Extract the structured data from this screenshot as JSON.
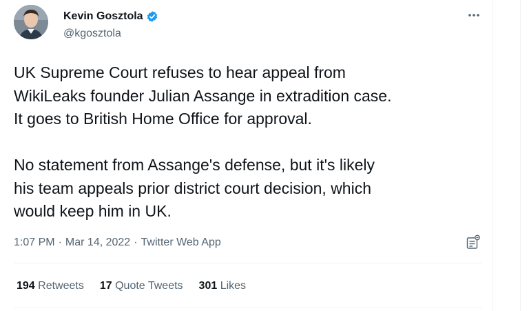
{
  "author": {
    "name": "Kevin Gosztola",
    "handle": "@kgosztola",
    "verified": true
  },
  "tweet": {
    "text": "UK Supreme Court refuses to hear appeal from\nWikiLeaks founder Julian Assange in extradition case.\nIt goes to British Home Office for approval.\n\nNo statement from Assange's defense, but it's likely\nhis team appeals prior district court decision, which\nwould keep him in UK.",
    "time": "1:07 PM",
    "separator": "·",
    "date": "Mar 14, 2022",
    "source": "Twitter Web App"
  },
  "stats": {
    "retweets_count": "194",
    "retweets_label": "Retweets",
    "quotes_count": "17",
    "quotes_label": "Quote Tweets",
    "likes_count": "301",
    "likes_label": "Likes"
  },
  "icons": {
    "verified": "verified-badge-icon",
    "more": "more-options-icon",
    "analytics": "analytics-icon"
  },
  "colors": {
    "accent": "#1d9bf0",
    "text_primary": "#0f1419",
    "text_secondary": "#536471",
    "divider": "#eff3f4"
  }
}
